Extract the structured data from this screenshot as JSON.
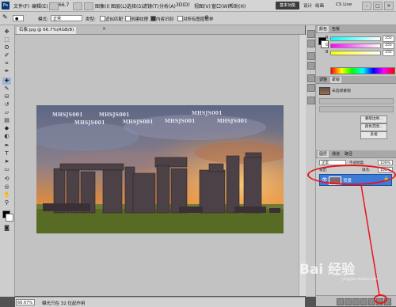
{
  "app": {
    "logo": "Ps",
    "menus": [
      "文件(F)",
      "编辑(E)",
      "图像(I)",
      "图层(L)",
      "选择(S)",
      "滤镜(T)",
      "分析(A)",
      "3D(D)",
      "视图(V)",
      "窗口(W)",
      "帮助(H)"
    ],
    "zoom_display": "66.7",
    "workspace_button": "基本功能",
    "workspace_links": [
      "设计",
      "绘画"
    ],
    "cs_live": "CS Live",
    "window_controls": [
      "–",
      "□",
      "✕"
    ]
  },
  "options_bar": {
    "mode_label": "模式:",
    "mode_value": "正常",
    "type_label": "类型:",
    "approx_match": "近似匹配",
    "create_texture": "创建纹理",
    "content_aware": "内容识别",
    "sample_all": "对所有图层取样"
  },
  "document": {
    "tab_label": "石像.jpg @ 66.7%(RGB/8)",
    "tab_close": "×",
    "watermarks": [
      "MHSJS001",
      "MHSJS001",
      "MHSJS001",
      "MHSJS001",
      "MHSJS001",
      "MHSJS001",
      "MHSJS001"
    ],
    "zoom": "66.67%",
    "info": "曝光只在 32 位起作用",
    "colors": {
      "canvas": "#c2c2c2",
      "sky_top": "#6b7590",
      "sky_glow": "#e48a3a",
      "ground": "#586b25"
    }
  },
  "panels": {
    "color_tabs": [
      "颜色",
      "色板"
    ],
    "rgb": [
      {
        "channel": "R",
        "value": "255"
      },
      {
        "channel": "G",
        "value": "255"
      },
      {
        "channel": "B",
        "value": "255"
      }
    ],
    "adjust_tabs": [
      "调整",
      "蒙版"
    ],
    "adjust_preset_label": "未选择蒙版",
    "adjust_buttons": [
      "蒙版边缘...",
      "颜色范围...",
      "反相"
    ],
    "layers_tabs": [
      "图层",
      "通道",
      "路径"
    ],
    "blend_mode": "正常",
    "opacity_label": "不透明度:",
    "opacity_value": "100%",
    "lock_label": "锁定:",
    "fill_label": "填充:",
    "fill_value": "100%",
    "layer": {
      "name": "背景",
      "lock_icon": "🔒",
      "eye": "👁"
    },
    "highlight_color": "#3d7bd8"
  },
  "annotations": {
    "color": "#e8141c"
  },
  "baidu": {
    "mark": "Bai 经验",
    "sub": "jingyan.baidu.com"
  }
}
